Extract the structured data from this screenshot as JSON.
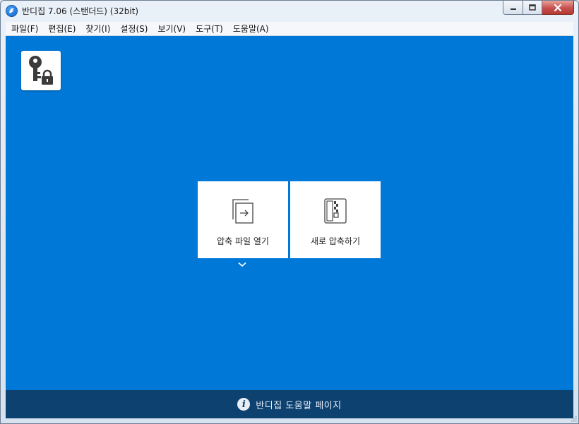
{
  "window": {
    "title": "반디집 7.06 (스탠더드) (32bit)",
    "icon": "bandizip-app-icon",
    "controls": {
      "minimize": "minimize-icon",
      "maximize": "maximize-icon",
      "close": "close-icon"
    }
  },
  "menu": [
    {
      "label": "파일(F)"
    },
    {
      "label": "편집(E)"
    },
    {
      "label": "찾기(I)"
    },
    {
      "label": "설정(S)"
    },
    {
      "label": "보기(V)"
    },
    {
      "label": "도구(T)"
    },
    {
      "label": "도움말(A)"
    }
  ],
  "main": {
    "background_color": "#0078d7",
    "key_button_icon": "key-lock-icon",
    "tiles": {
      "open": {
        "label": "압축 파일 열기",
        "icon": "open-archive-icon"
      },
      "new": {
        "label": "새로 압축하기",
        "icon": "new-archive-icon"
      }
    }
  },
  "help_bar": {
    "label": "반디집 도움말 페이지",
    "icon": "info-icon",
    "color": "#0d4170"
  }
}
